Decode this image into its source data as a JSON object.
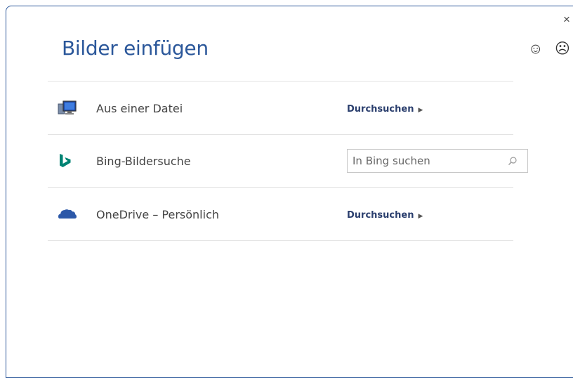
{
  "dialog": {
    "title": "Bilder einfügen",
    "close_glyph": "×",
    "smile_glyph": "☺",
    "frown_glyph": "☹"
  },
  "rows": [
    {
      "icon": "computer-file-icon",
      "label": "Aus einer Datei",
      "action": "Durchsuchen",
      "action_arrow": "▶"
    },
    {
      "icon": "bing-logo-icon",
      "label": "Bing-Bildersuche",
      "search_placeholder": "In Bing suchen"
    },
    {
      "icon": "onedrive-cloud-icon",
      "label": "OneDrive – Persönlich",
      "action": "Durchsuchen",
      "action_arrow": "▶"
    }
  ],
  "colors": {
    "accent": "#2b579a",
    "bing": "#008373",
    "onedrive": "#2c58a8"
  }
}
